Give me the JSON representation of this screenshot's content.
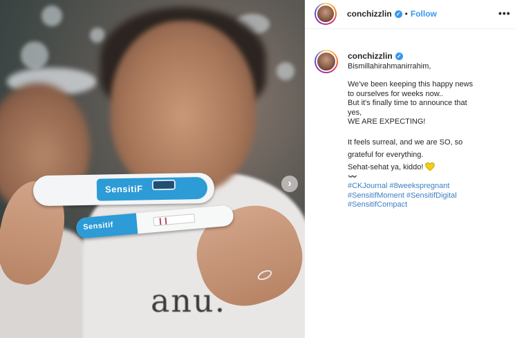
{
  "post": {
    "username": "conchizzlin",
    "follow_label": "Follow",
    "separator": "•",
    "more_label": "•••"
  },
  "photo": {
    "shirt_text": "anu.",
    "test_brand_1": "SensitiF",
    "test_brand_2": "Sensitif",
    "next_label": "›"
  },
  "caption": {
    "username": "conchizzlin",
    "line1": "Bismillahirahmanirrahim,",
    "para2": "We've been keeping this happy news\nto ourselves for weeks now..\nBut it's finally time to announce that\nyes,\nWE ARE EXPECTING!",
    "para3": "It feels surreal, and we are SO, so\ngrateful for everything.\nSehat-sehat ya, kiddo!",
    "divider": "〰️",
    "hashtags": [
      "#CKJournal #8weekspregnant",
      "#SensitifMoment #SensitifDigital",
      "#SensitifCompact"
    ]
  },
  "colors": {
    "link_blue": "#3897f0",
    "hashtag_blue": "#3a7fc4",
    "heart_yellow": "#f5d10d",
    "brand_blue": "#2c9bd6"
  },
  "icons": [
    "verified-badge-icon",
    "more-options-icon",
    "yellow-heart-icon",
    "carousel-next-icon"
  ]
}
